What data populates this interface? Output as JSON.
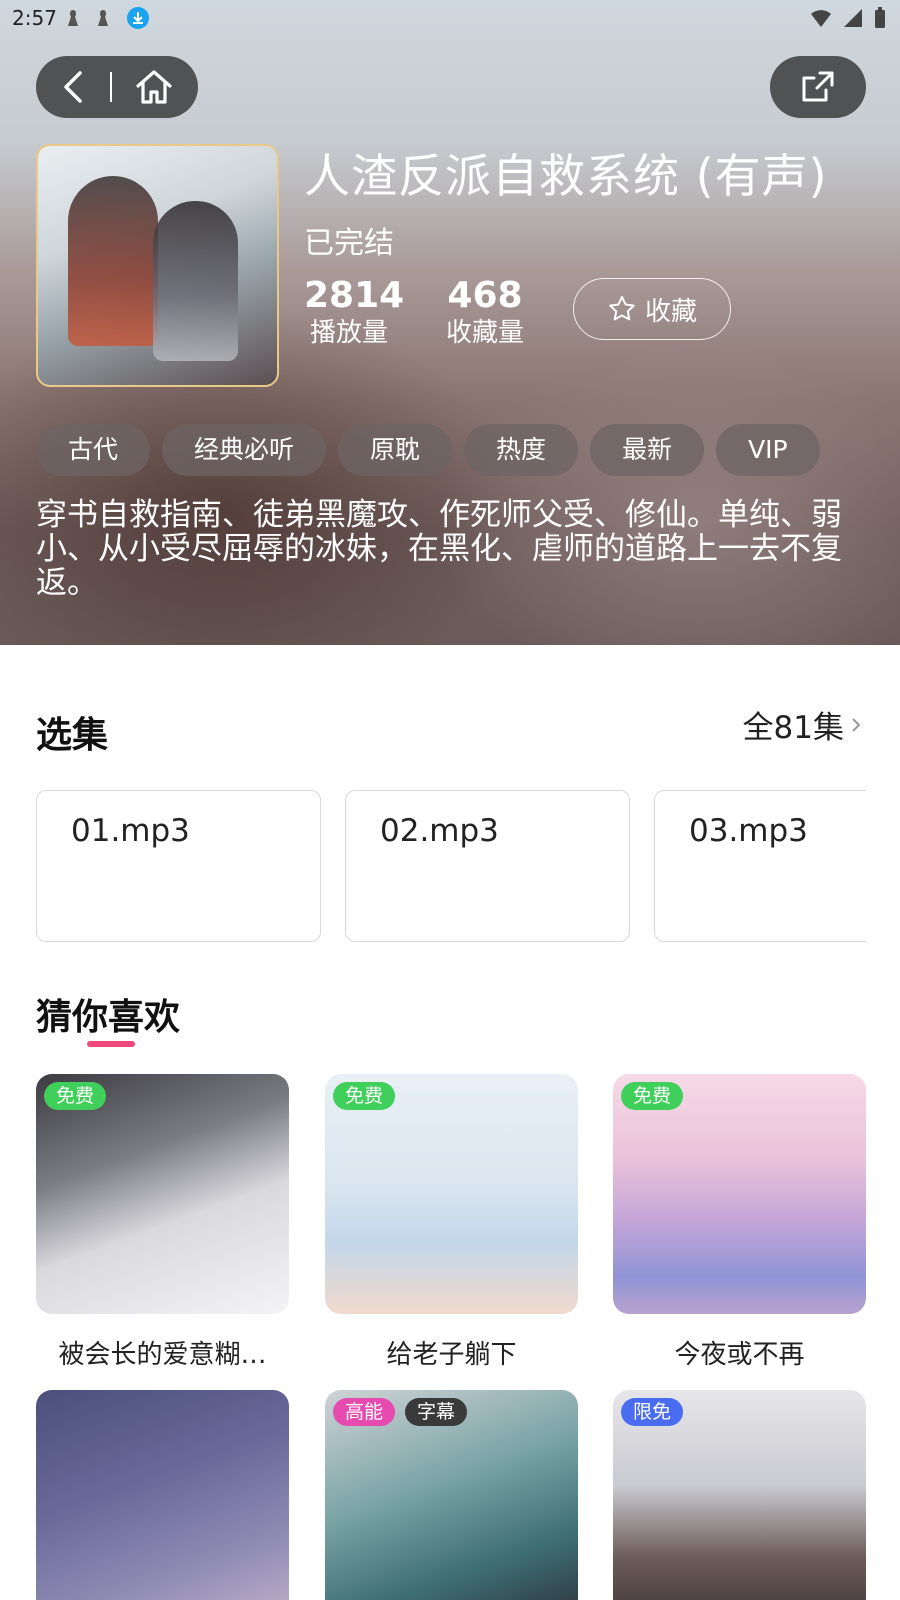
{
  "status_bar": {
    "time": "2:57",
    "icons": [
      "notification-icon",
      "notification-icon",
      "download-icon",
      "wifi-icon",
      "signal-icon",
      "battery-icon"
    ]
  },
  "album": {
    "title": "人渣反派自救系统 (有声)",
    "status": "已完结",
    "plays": "2814",
    "plays_label": "播放量",
    "favorites": "468",
    "favorites_label": "收藏量",
    "favorite_button": "收藏",
    "tags": [
      "古代",
      "经典必听",
      "原耽",
      "热度",
      "最新",
      "VIP"
    ],
    "description": "穿书自救指南、徒弟黑魔攻、作死师父受、修仙。单纯、弱小、从小受尽屈辱的冰妹，在黑化、虐师的道路上一去不复返。"
  },
  "episodes": {
    "title": "选集",
    "all_label": "全81集",
    "items": [
      "01.mp3",
      "02.mp3",
      "03.mp3"
    ]
  },
  "recommend": {
    "title": "猜你喜欢",
    "items": [
      {
        "name": "被会长的爱意糊…",
        "badges": [
          {
            "text": "免费",
            "color": "#3fcf5a"
          }
        ]
      },
      {
        "name": "给老子躺下",
        "badges": [
          {
            "text": "免费",
            "color": "#3fcf5a"
          }
        ]
      },
      {
        "name": "今夜或不再",
        "badges": [
          {
            "text": "免费",
            "color": "#3fcf5a"
          }
        ]
      },
      {
        "name": "",
        "badges": []
      },
      {
        "name": "",
        "badges": [
          {
            "text": "高能",
            "color": "#e64bb0"
          },
          {
            "text": "字幕",
            "color": "#3a3a3a"
          }
        ]
      },
      {
        "name": "",
        "badges": [
          {
            "text": "限免",
            "color": "#4a6cf0"
          }
        ]
      }
    ]
  },
  "colors": {
    "accent": "#f0487a",
    "free_badge": "#3fcf5a",
    "cover_border": "#e8c987"
  }
}
